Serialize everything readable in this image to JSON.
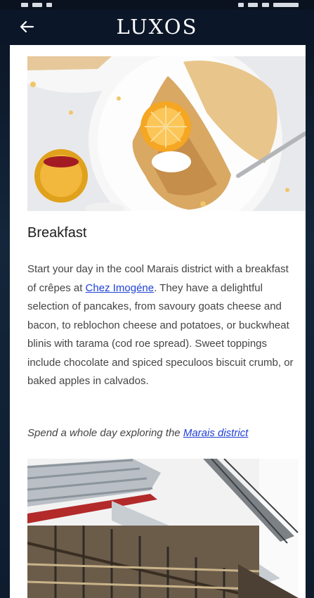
{
  "app_bar": {
    "title": "LUXOS"
  },
  "icons": {
    "back": "arrow-left-icon"
  },
  "article": {
    "heading": "Breakfast",
    "paragraph_before_link": "Start your day in the cool Marais district with a breakfast of crêpes at ",
    "link_text": "Chez Imogéne",
    "paragraph_after_link": ". They have a delightful selection of pancakes, from savoury goats cheese and bacon, to reblochon cheese and potatoes, or buckwheat blinis with tarama (cod roe spread). Sweet toppings include chocolate and spiced speculoos biscuit crumb, or baked apples in calvados.",
    "note_before_link": "Spend a whole day exploring the ",
    "note_link_text": "Marais district"
  },
  "colors": {
    "app_bar_background": "#0b1628",
    "link": "#1e3fd6",
    "body_text": "#444444"
  }
}
